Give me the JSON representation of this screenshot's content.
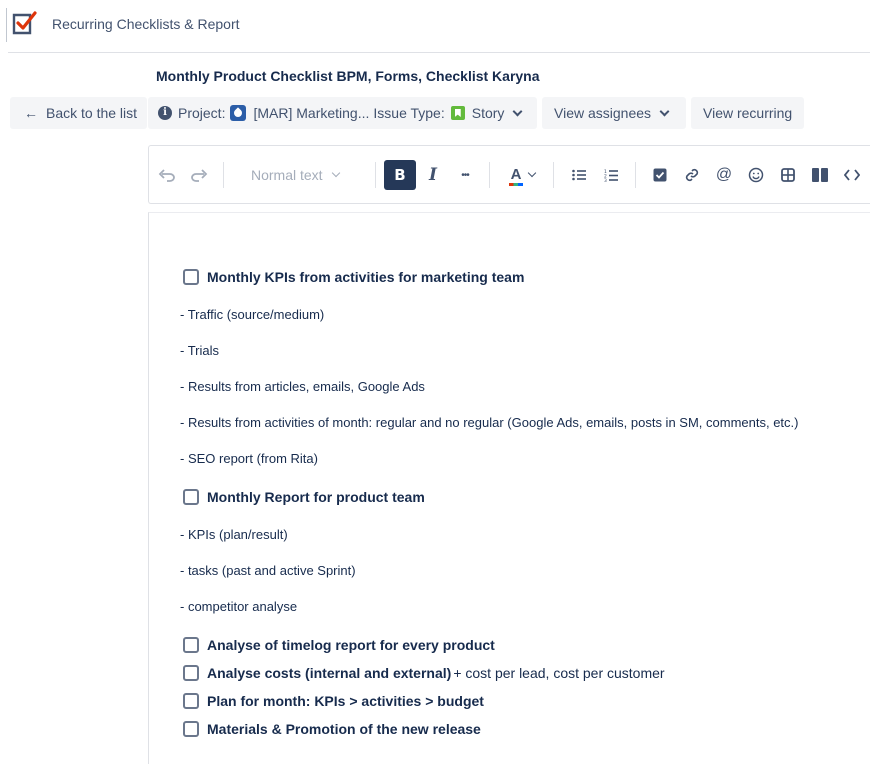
{
  "app": {
    "title": "Recurring Checklists & Report"
  },
  "issue": {
    "summary": "Monthly Product Checklist BPM, Forms, Checklist Karyna"
  },
  "actions": {
    "back_label": "Back to the list",
    "project_prefix": "Project:",
    "project_name": "[MAR] Marketing...",
    "issue_type_prefix": "Issue Type:",
    "issue_type": "Story",
    "view_assignees": "View assignees",
    "view_recurring": "View recurring"
  },
  "editor_toolbar": {
    "text_style": "Normal text",
    "bold": "B",
    "italic": "I",
    "more": "•••",
    "text_color": "A"
  },
  "content": {
    "sections": [
      {
        "task": "Monthly KPIs from activities for marketing team",
        "lines": [
          "- Traffic (source/medium)",
          "- Trials",
          "- Results from articles, emails, Google Ads",
          "- Results from activities of month: regular and no regular (Google Ads, emails, posts in SM, comments, etc.)",
          "- SEO report (from Rita)"
        ]
      },
      {
        "task": "Monthly Report for product team",
        "lines": [
          "- KPIs (plan/result)",
          "- tasks (past and active Sprint)",
          "- competitor analyse"
        ]
      }
    ],
    "tasks": [
      {
        "label": "Analyse of timelog report for every product",
        "extra": ""
      },
      {
        "label": "Analyse costs (internal and external)",
        "extra": "+ cost per lead, cost per customer"
      },
      {
        "label": "Plan for month: KPIs > activities > budget",
        "extra": ""
      },
      {
        "label": "Materials & Promotion of the new release",
        "extra": ""
      }
    ]
  },
  "colors": {
    "primary_text": "#172b4d",
    "secondary_text": "#42526e",
    "button_bg": "#f4f5f7",
    "bold_active": "#253858",
    "logo_accent": "#de350b",
    "story_green": "#63ba3c"
  }
}
